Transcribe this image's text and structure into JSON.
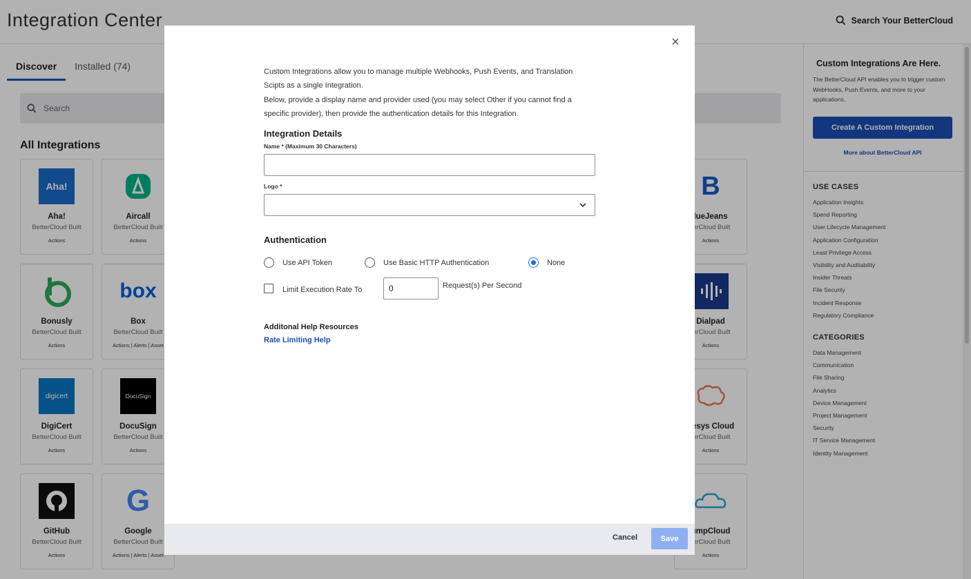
{
  "header": {
    "title": "Integration Center",
    "search_label": "Search Your BetterCloud"
  },
  "tabs": [
    {
      "label": "Discover",
      "active": true
    },
    {
      "label": "Installed (74)",
      "active": false
    }
  ],
  "search": {
    "placeholder": "Search"
  },
  "section_title": "All Integrations",
  "cards": [
    {
      "name": "Aha!",
      "logo_text": "Aha!",
      "logo_color": "#1b6bcc",
      "built": "BetterCloud Built",
      "caps": "Actions"
    },
    {
      "name": "Aircall",
      "logo_text": "",
      "logo_color": "#00b388",
      "built": "BetterCloud Built",
      "caps": "Actions"
    },
    {
      "name": "Bonusly",
      "logo_text": "",
      "logo_color": "#2bab5a",
      "built": "BetterCloud Built",
      "caps": "Actions"
    },
    {
      "name": "Box",
      "logo_text": "box",
      "logo_color": "#0061d5",
      "built": "BetterCloud Built",
      "caps": "Actions | Alerts | Asset"
    },
    {
      "name": "DigiCert",
      "logo_text": "digicert",
      "logo_color": "#0a75c2",
      "built": "BetterCloud Built",
      "caps": "Actions"
    },
    {
      "name": "DocuSign",
      "logo_text": "DocuSign",
      "logo_color": "#000000",
      "built": "BetterCloud Built",
      "caps": "Actions"
    },
    {
      "name": "GitHub",
      "logo_text": "",
      "logo_color": "#111111",
      "built": "BetterCloud Built",
      "caps": "Actions"
    },
    {
      "name": "Google",
      "logo_text": "G",
      "logo_color": "#4285f4",
      "built": "BetterCloud Built",
      "caps": "Actions | Alerts | Asset"
    },
    {
      "name": "lueJeans",
      "logo_text": "B",
      "logo_color": "#1a5ac6",
      "built": "terCloud Built",
      "caps": "Actions"
    },
    {
      "name": "Dialpad",
      "logo_text": "",
      "logo_color": "#1a3a8f",
      "built": "terCloud Built",
      "caps": "Actions"
    },
    {
      "name": "nesys Cloud",
      "logo_text": "",
      "logo_color": "#e07a4c",
      "built": "terCloud Built",
      "caps": "Actions"
    },
    {
      "name": "umpCloud",
      "logo_text": "",
      "logo_color": "#2a9fd6",
      "built": "terCloud Built",
      "caps": "Actions"
    }
  ],
  "sidebar": {
    "title": "Custom Integrations Are Here.",
    "description": "The BetterCloud API enables you to trigger custom WebHooks, Push Events, and more to your applications.",
    "button_label": "Create A Custom Integration",
    "link_label": "More about BetterCloud API",
    "use_cases_heading": "USE CASES",
    "use_cases": [
      "Application Insights",
      "Spend Reporting",
      "User Lifecycle Management",
      "Application Configuration",
      "Least Privilege Access",
      "Visibility and Auditability",
      "Insider Threats",
      "File Security",
      "Incident Response",
      "Regulatory Compliance"
    ],
    "categories_heading": "CATEGORIES",
    "categories": [
      "Data Management",
      "Communication",
      "File Sharing",
      "Analytics",
      "Device Management",
      "Project Management",
      "Security",
      "IT Service Management",
      "Identity Management"
    ]
  },
  "modal": {
    "intro_1": "Custom Integrations allow you to manage multiple Webhooks, Push Events, and Translation Scipts as a single Integration.",
    "intro_2": "Below, provide a display name and provider used (you may select Other if you cannot find a specific provider), then provide the authentication details for this Integration.",
    "details_heading": "Integration Details",
    "name_label": "Name * (Maximum 30 Characters)",
    "name_value": "",
    "logo_label": "Logo *",
    "logo_value": "",
    "auth_heading": "Authentication",
    "auth_options": [
      {
        "label": "Use API Token",
        "checked": false
      },
      {
        "label": "Use Basic HTTP Authentication",
        "checked": false
      },
      {
        "label": "None",
        "checked": true
      }
    ],
    "limit_label": "Limit Execution Rate To",
    "limit_checked": false,
    "rate_value": "0",
    "rate_unit": "Request(s) Per Second",
    "help_heading": "Additonal Help Resources",
    "help_link": "Rate Limiting Help",
    "cancel_label": "Cancel",
    "save_label": "Save",
    "close_symbol": "×"
  },
  "colors": {
    "accent": "#1c4fb7",
    "radio_active": "#1c6fe0",
    "save_disabled": "#8fb0f0"
  }
}
